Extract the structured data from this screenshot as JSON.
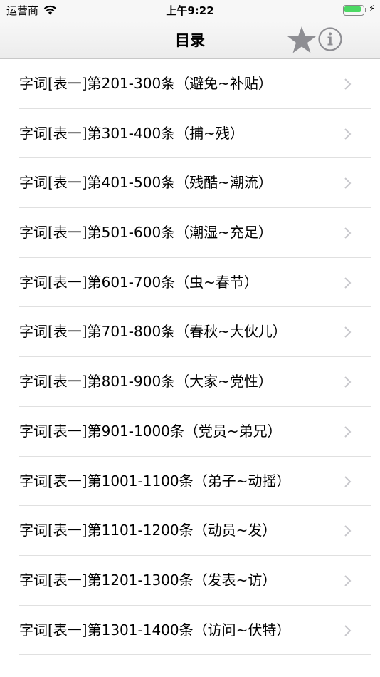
{
  "status_bar": {
    "carrier": "运营商",
    "time": "上午9:22",
    "battery_level": 1.0
  },
  "nav": {
    "title": "目录",
    "favorite_icon": "star-icon",
    "info_icon": "info-icon"
  },
  "list": {
    "items": [
      {
        "label": "字词[表一]第201-300条（避免~补贴）"
      },
      {
        "label": "字词[表一]第301-400条（捕~残）"
      },
      {
        "label": "字词[表一]第401-500条（残酷~潮流）"
      },
      {
        "label": "字词[表一]第501-600条（潮湿~充足）"
      },
      {
        "label": "字词[表一]第601-700条（虫~春节）"
      },
      {
        "label": "字词[表一]第701-800条（春秋~大伙儿）"
      },
      {
        "label": "字词[表一]第801-900条（大家~党性）"
      },
      {
        "label": "字词[表一]第901-1000条（党员~弟兄）"
      },
      {
        "label": "字词[表一]第1001-1100条（弟子~动摇）"
      },
      {
        "label": "字词[表一]第1101-1200条（动员~发）"
      },
      {
        "label": "字词[表一]第1201-1300条（发表~访）"
      },
      {
        "label": "字词[表一]第1301-1400条（访问~伏特）"
      }
    ]
  },
  "colors": {
    "accent_gray": "#8e8e93",
    "battery_green": "#4cd964"
  }
}
